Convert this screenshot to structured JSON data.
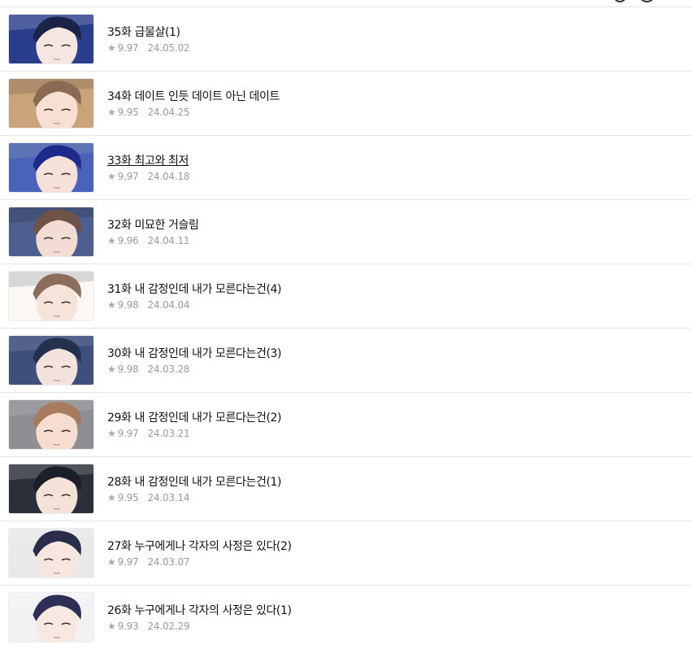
{
  "episodes": [
    {
      "title": "35화 급물살(1)",
      "rating": "9.97",
      "date": "24.05.02",
      "hover": false,
      "thumb": {
        "bg": "#2a3d8a",
        "skin": "#f6e6e0",
        "hair": "#1b2348",
        "accent": "#ffffff"
      }
    },
    {
      "title": "34화 데이트 인듯 데이트 아닌 데이트",
      "rating": "9.95",
      "date": "24.04.25",
      "hover": false,
      "thumb": {
        "bg": "#c9a37a",
        "skin": "#f7dfd3",
        "hair": "#8a6a55",
        "accent": "#3a2e2a"
      }
    },
    {
      "title": "33화 최고와 최저",
      "rating": "9.97",
      "date": "24.04.18",
      "hover": true,
      "thumb": {
        "bg": "#4a63b8",
        "skin": "#f6e1da",
        "hair": "#1d2a8c",
        "accent": "#b9c0a4"
      }
    },
    {
      "title": "32화 미묘한 거슬림",
      "rating": "9.96",
      "date": "24.04.11",
      "hover": false,
      "thumb": {
        "bg": "#4d5f8f",
        "skin": "#f2dcd3",
        "hair": "#6e5448",
        "accent": "#1e1e1e"
      }
    },
    {
      "title": "31화 내 감정인데 내가 모른다는건(4)",
      "rating": "9.98",
      "date": "24.04.04",
      "hover": false,
      "thumb": {
        "bg": "#fbf8f4",
        "skin": "#f6e3da",
        "hair": "#8a6d5c",
        "accent": "#3a4357"
      }
    },
    {
      "title": "30화 내 감정인데 내가 모른다는건(3)",
      "rating": "9.98",
      "date": "24.03.28",
      "hover": false,
      "thumb": {
        "bg": "#3d4f7a",
        "skin": "#f4e2dc",
        "hair": "#25304f",
        "accent": "#b8c2dc"
      }
    },
    {
      "title": "29화 내 감정인데 내가 모른다는건(2)",
      "rating": "9.97",
      "date": "24.03.21",
      "hover": false,
      "thumb": {
        "bg": "#8e8e93",
        "skin": "#f7dcd0",
        "hair": "#a77b5e",
        "accent": "#dcdcdc"
      }
    },
    {
      "title": "28화 내 감정인데 내가 모른다는건(1)",
      "rating": "9.95",
      "date": "24.03.14",
      "hover": false,
      "thumb": {
        "bg": "#2b2f3a",
        "skin": "#f4e1d8",
        "hair": "#1b1f2a",
        "accent": "#f2f2f2"
      }
    },
    {
      "title": "27화 누구에게나 각자의 사정은 있다(2)",
      "rating": "9.97",
      "date": "24.03.07",
      "hover": false,
      "thumb": {
        "bg": "#e9e9ea",
        "skin": "#f6e6df",
        "hair": "#2a2d4a",
        "accent": "#f4f4f4"
      }
    },
    {
      "title": "26화 누구에게나 각자의 사정은 있다(1)",
      "rating": "9.93",
      "date": "24.02.29",
      "hover": false,
      "thumb": {
        "bg": "#f2f2f4",
        "skin": "#f7e8e2",
        "hair": "#2d2f57",
        "accent": "#ffffff"
      }
    }
  ],
  "star_icon": "★",
  "colors": {
    "title": "#111111",
    "meta": "#9a9a9a",
    "divider": "#e5e5e5"
  }
}
